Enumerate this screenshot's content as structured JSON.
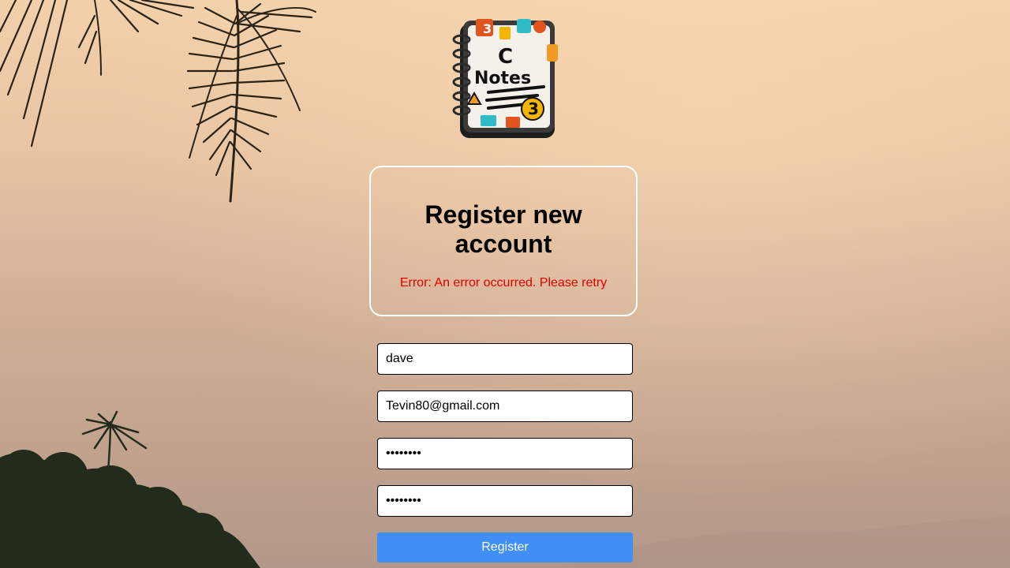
{
  "logo": {
    "text": "Notes",
    "badge_number": "3",
    "badge_letter": "C"
  },
  "register": {
    "title": "Register new account",
    "error": "Error: An error occurred. Please retry"
  },
  "form": {
    "username": "dave",
    "email": "Tevin80@gmail.com",
    "password": "password",
    "confirm_password": "password",
    "submit_label": "Register"
  },
  "colors": {
    "accent": "#3f8ff4",
    "error": "#e00000",
    "card_border": "#ffffff"
  }
}
